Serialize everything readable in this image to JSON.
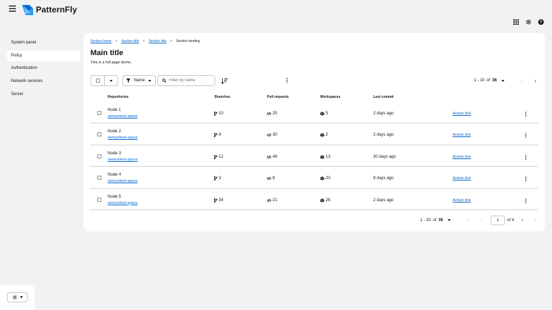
{
  "masthead": {
    "brand": "PatternFly",
    "icons": [
      "menu-icon",
      "apps-grid-icon",
      "settings-gear-icon",
      "help-icon"
    ]
  },
  "sidebar": {
    "items": [
      {
        "label": "System panel",
        "active": false
      },
      {
        "label": "Policy",
        "active": true
      },
      {
        "label": "Authentication",
        "active": false
      },
      {
        "label": "Network services",
        "active": false
      },
      {
        "label": "Server",
        "active": false
      }
    ],
    "theme_icon": "sun-icon"
  },
  "breadcrumb": {
    "items": [
      "Section home",
      "Section title",
      "Section title"
    ],
    "current": "Section landing"
  },
  "page": {
    "title": "Main title",
    "description": "This is a full page demo."
  },
  "toolbar": {
    "filter_label": "Name",
    "search_placeholder": "Filter by name",
    "pager": {
      "range": "1 - 10",
      "of": "of",
      "total": "36"
    }
  },
  "table": {
    "headers": {
      "repositories": "Repositories",
      "branches": "Branches",
      "pull_requests": "Pull requests",
      "workspaces": "Workspaces",
      "last_commit": "Last commit"
    },
    "rows": [
      {
        "name": "Node 1",
        "link": "siemur/test-space",
        "branches": "10",
        "prs": "25",
        "workspaces": "5",
        "last_commit": "2 days ago",
        "action": "Action link"
      },
      {
        "name": "Node 2",
        "link": "siemur/test-space",
        "branches": "8",
        "prs": "30",
        "workspaces": "2",
        "last_commit": "2 days ago",
        "action": "Action link"
      },
      {
        "name": "Node 3",
        "link": "siemur/test-space",
        "branches": "12",
        "prs": "48",
        "workspaces": "13",
        "last_commit": "30 days ago",
        "action": "Action link"
      },
      {
        "name": "Node 4",
        "link": "siemur/test-space",
        "branches": "3",
        "prs": "8",
        "workspaces": "20",
        "last_commit": "8 days ago",
        "action": "Action link"
      },
      {
        "name": "Node 5",
        "link": "siemur/test-space",
        "branches": "34",
        "prs": "21",
        "workspaces": "26",
        "last_commit": "2 days ago",
        "action": "Action link"
      }
    ]
  },
  "bottom_pager": {
    "range": "1 - 10",
    "of": "of",
    "total": "36",
    "page": "1",
    "of_pages": "of 4"
  },
  "colors": {
    "link": "#0066cc",
    "background": "#f2f2f2",
    "card": "#ffffff",
    "brand": "#0066cc"
  }
}
